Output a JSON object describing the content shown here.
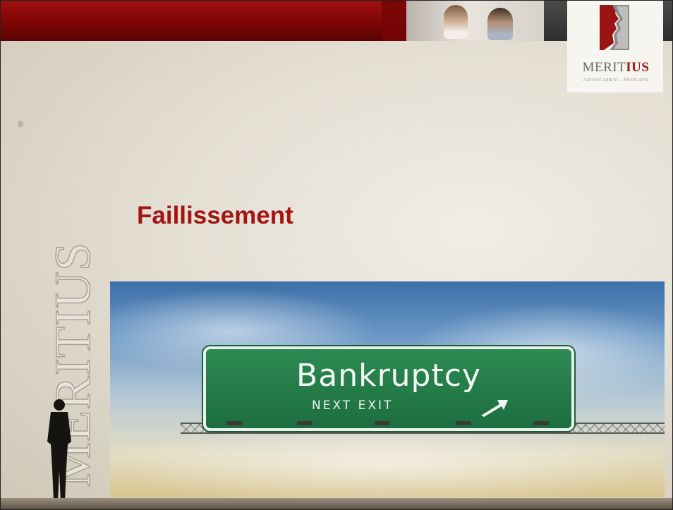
{
  "brand": {
    "name_part1": "MERIT",
    "name_part2": "IUS",
    "tagline": "ADVOCATEN - AVOCATS",
    "vertical_wordmark": "MERITIUS",
    "registered_mark": "®"
  },
  "slide": {
    "title": "Faillissement"
  },
  "photo": {
    "sign_title": "Bankruptcy",
    "sign_subtitle": "NEXT EXIT"
  },
  "colors": {
    "accent_red": "#a31414",
    "sign_green": "#23794a"
  }
}
